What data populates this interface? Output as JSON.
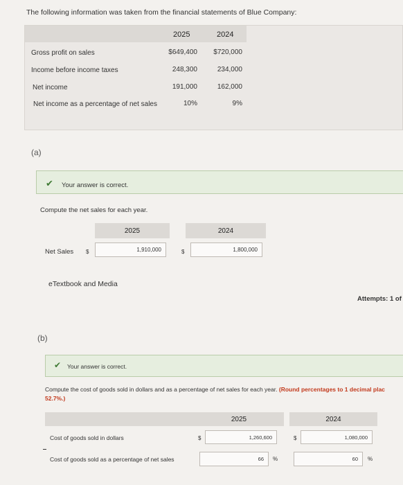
{
  "intro": "The following information was taken from the financial statements of Blue Company:",
  "info_table": {
    "years": [
      "2025",
      "2024"
    ],
    "rows": [
      {
        "label": "Gross profit on sales",
        "v2025": "$649,400",
        "v2024": "$720,000"
      },
      {
        "label": "Income before income taxes",
        "v2025": "248,300",
        "v2024": "234,000"
      },
      {
        "label": "Net income",
        "v2025": "191,000",
        "v2024": "162,000"
      },
      {
        "label": "Net income as a percentage of net sales",
        "v2025": "10%",
        "v2024": "9%"
      }
    ]
  },
  "part_a": {
    "label": "(a)",
    "status": "Your answer is correct.",
    "question": "Compute the net sales for each year.",
    "col_2025": "2025",
    "col_2024": "2024",
    "row_label": "Net Sales",
    "currency": "$",
    "net_sales_2025": "1,910,000",
    "net_sales_2024": "1,800,000",
    "etextbook": "eTextbook and Media",
    "attempts": "Attempts: 1 of"
  },
  "part_b": {
    "label": "(b)",
    "status": "Your answer is correct.",
    "question_main": "Compute the cost of goods sold in dollars and as a percentage of net sales for each year.",
    "question_note": "(Round percentages to 1 decimal plac",
    "question_example": "52.7%.)",
    "col_2025": "2025",
    "col_2024": "2024",
    "currency": "$",
    "row1_label": "Cost of goods sold in dollars",
    "cogs_2025": "1,260,600",
    "cogs_2024": "1,080,000",
    "row2_label": "Cost of goods sold as a percentage of net sales",
    "pct_2025": "66",
    "pct_2024": "60",
    "pct_sign": "%"
  },
  "colors": {
    "correct_bg": "#e6eedf",
    "check": "#3f7a34",
    "round_note": "#c23a1d"
  }
}
